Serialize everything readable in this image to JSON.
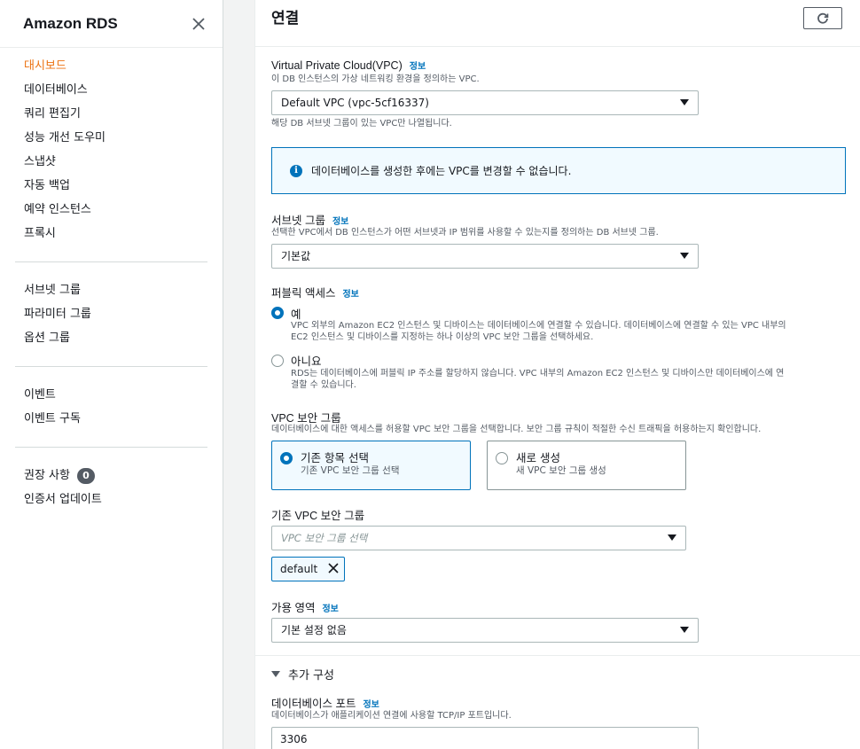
{
  "sidebar": {
    "title": "Amazon RDS",
    "group1": [
      "대시보드",
      "데이터베이스",
      "쿼리 편집기",
      "성능 개선 도우미",
      "스냅샷",
      "자동 백업",
      "예약 인스턴스",
      "프록시"
    ],
    "group2": [
      "서브넷 그룹",
      "파라미터 그룹",
      "옵션 그룹"
    ],
    "group3": [
      "이벤트",
      "이벤트 구독"
    ],
    "recommendations": "권장 사항",
    "recommendations_count": "0",
    "cert_update": "인증서 업데이트",
    "active_index": 0
  },
  "main": {
    "section_title": "연결",
    "info_link": "정보",
    "vpc": {
      "label": "Virtual Private Cloud(VPC)",
      "desc": "이 DB 인스턴스의 가상 네트워킹 환경을 정의하는 VPC.",
      "value": "Default VPC (vpc-5cf16337)",
      "hint": "해당 DB 서브넷 그룹이 있는 VPC만 나열됩니다."
    },
    "vpc_notice": "데이터베이스를 생성한 후에는 VPC를 변경할 수 없습니다.",
    "subnet": {
      "label": "서브넷 그룹",
      "desc": "선택한 VPC에서 DB 인스턴스가 어떤 서브넷과 IP 범위를 사용할 수 있는지를 정의하는 DB 서브넷 그룹.",
      "value": "기본값"
    },
    "public_access": {
      "label": "퍼블릭 액세스",
      "yes_title": "예",
      "yes_desc_1": "VPC 외부의 Amazon EC2 인스턴스 및 디바이스는 데이터베이스에 연결할 수 있습니다. 데이터베이스에 연결할 수 있는 VPC 내부의",
      "yes_desc_2": "EC2 인스턴스 및 디바이스를 지정하는 하나 이상의 VPC 보안 그룹을 선택하세요.",
      "no_title": "아니요",
      "no_desc_1": "RDS는 데이터베이스에 퍼블릭 IP 주소를 할당하지 않습니다. VPC 내부의 Amazon EC2 인스턴스 및 디바이스만 데이터베이스에 연",
      "no_desc_2": "결할 수 있습니다.",
      "selected": "yes"
    },
    "security_group": {
      "label": "VPC 보안 그룹",
      "desc": "데이터베이스에 대한 액세스를 허용할 VPC 보안 그룹을 선택합니다. 보안 그룹 규칙이 적절한 수신 트래픽을 허용하는지 확인합니다.",
      "existing_title": "기존 항목 선택",
      "existing_desc": "기존 VPC 보안 그룹 선택",
      "new_title": "새로 생성",
      "new_desc": "새 VPC 보안 그룹 생성",
      "selected": "existing"
    },
    "existing_sg": {
      "label": "기존 VPC 보안 그룹",
      "placeholder": "VPC 보안 그룹 선택",
      "token": "default"
    },
    "az": {
      "label": "가용 영역",
      "value": "기본 설정 없음"
    },
    "additional_config": "추가 구성",
    "port": {
      "label": "데이터베이스 포트",
      "desc": "데이터베이스가 애플리케이션 연결에 사용할 TCP/IP 포트입니다.",
      "value": "3306"
    }
  },
  "colors": {
    "accent_orange": "#ec7211",
    "link_blue": "#0073bb",
    "info_bg": "#f1faff"
  },
  "icons": [
    "close-icon",
    "refresh-icon",
    "info-icon",
    "caret-down-icon",
    "remove-token-icon",
    "expand-triangle-icon"
  ]
}
